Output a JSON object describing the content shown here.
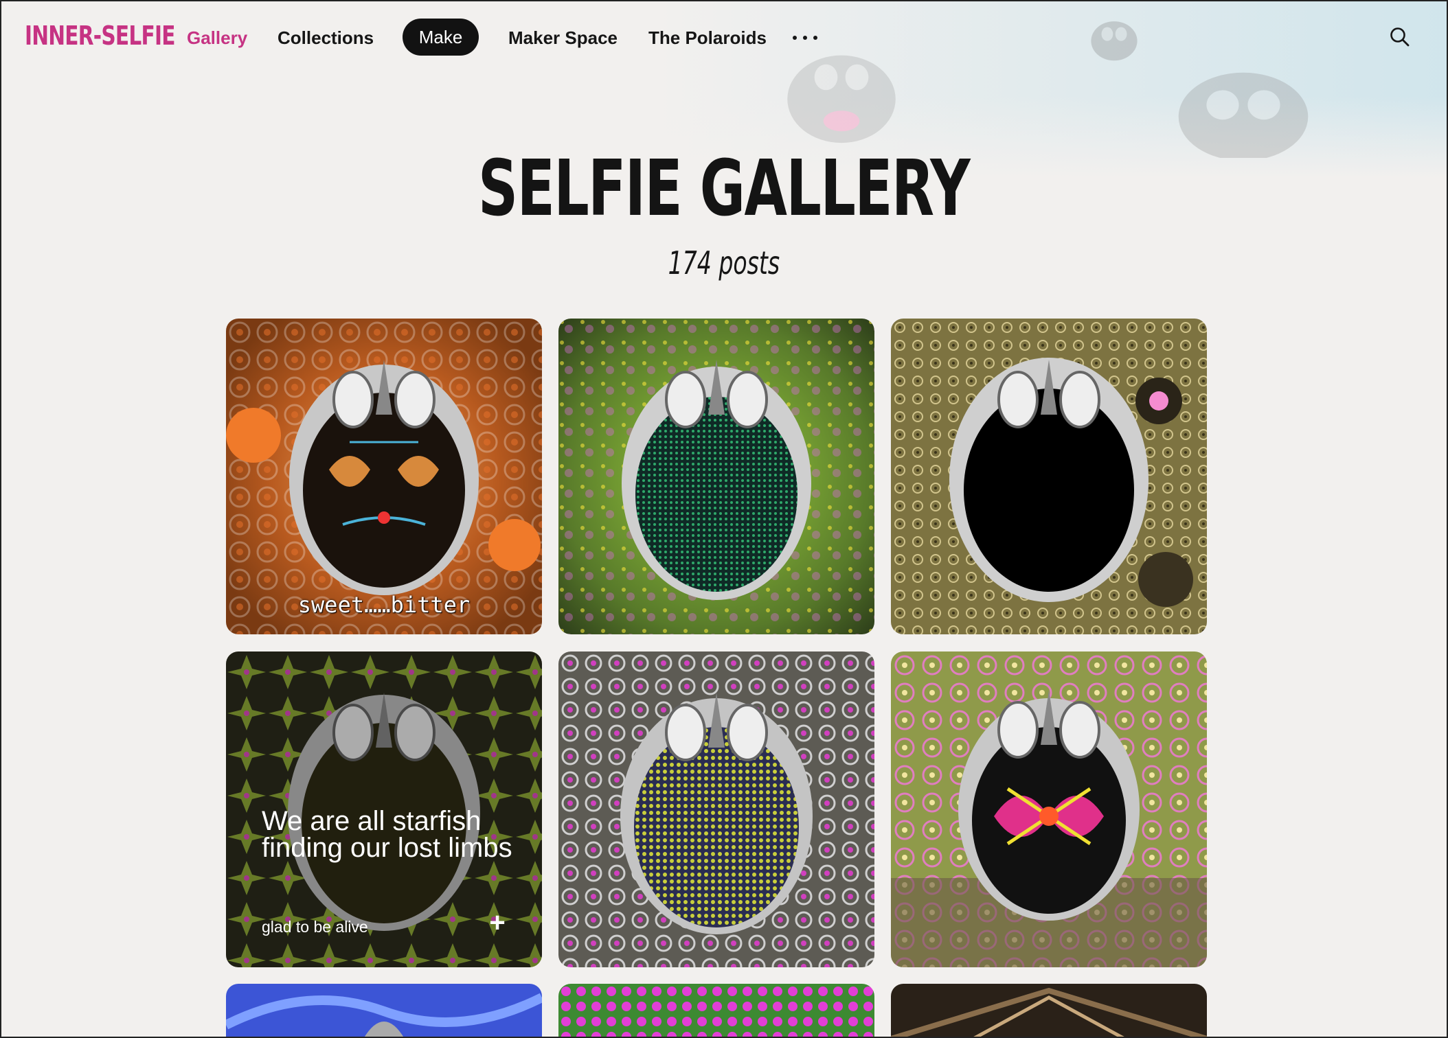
{
  "brand": "INNER-SELFIE",
  "nav": {
    "gallery": "Gallery",
    "collections": "Collections",
    "make": "Make",
    "maker_space": "Maker Space",
    "polaroids": "The Polaroids",
    "more_icon": "ellipsis-icon",
    "search_icon": "search-icon"
  },
  "page": {
    "title": "SELFIE GALLERY",
    "count": "174 posts"
  },
  "tiles": [
    {
      "stamp": "sweet……bitter",
      "theme": "orange"
    },
    {
      "theme": "green"
    },
    {
      "theme": "olive-black"
    },
    {
      "caption": "We are all starfish finding our lost limbs",
      "sub": "glad to be alive",
      "theme": "magenta-dark"
    },
    {
      "theme": "kaleidoscope"
    },
    {
      "theme": "pink-green"
    },
    {
      "theme": "blue"
    },
    {
      "theme": "magenta-flowers"
    },
    {
      "theme": "bronze"
    }
  ],
  "colors": {
    "brand": "#c63383",
    "pill_bg": "#121212",
    "background": "#f2f0ee"
  }
}
